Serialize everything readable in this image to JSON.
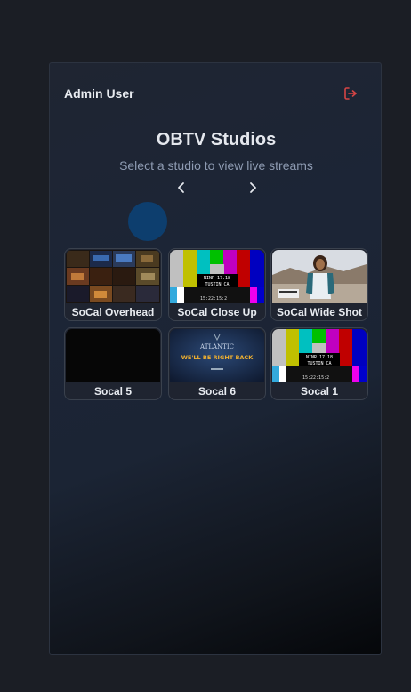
{
  "header": {
    "user_name": "Admin User",
    "logout_icon": "logout-icon",
    "logout_color": "#d64545"
  },
  "main": {
    "title": "OBTV Studios",
    "subtitle": "Select a studio to view live streams",
    "prev_icon": "chevron-left-icon",
    "next_icon": "chevron-right-icon",
    "accent": "#0d3e6e"
  },
  "streams": [
    {
      "label": "SoCal Overhead",
      "thumbnail": "multiview"
    },
    {
      "label": "SoCal Close Up",
      "thumbnail": "color-bars"
    },
    {
      "label": "SoCal Wide Shot",
      "thumbnail": "person-outdoors"
    },
    {
      "label": "Socal 5",
      "thumbnail": "black"
    },
    {
      "label": "Socal 6",
      "thumbnail": "slate"
    },
    {
      "label": "Socal 1",
      "thumbnail": "color-bars"
    }
  ],
  "thumb_text": {
    "bars_line1": "NINR 17.18",
    "bars_line2": "TUSTIN CA",
    "bars_line3": "15:22:15:2",
    "slate_brand": "ATLANTIC",
    "slate_message": "WE'LL BE RIGHT BACK"
  }
}
